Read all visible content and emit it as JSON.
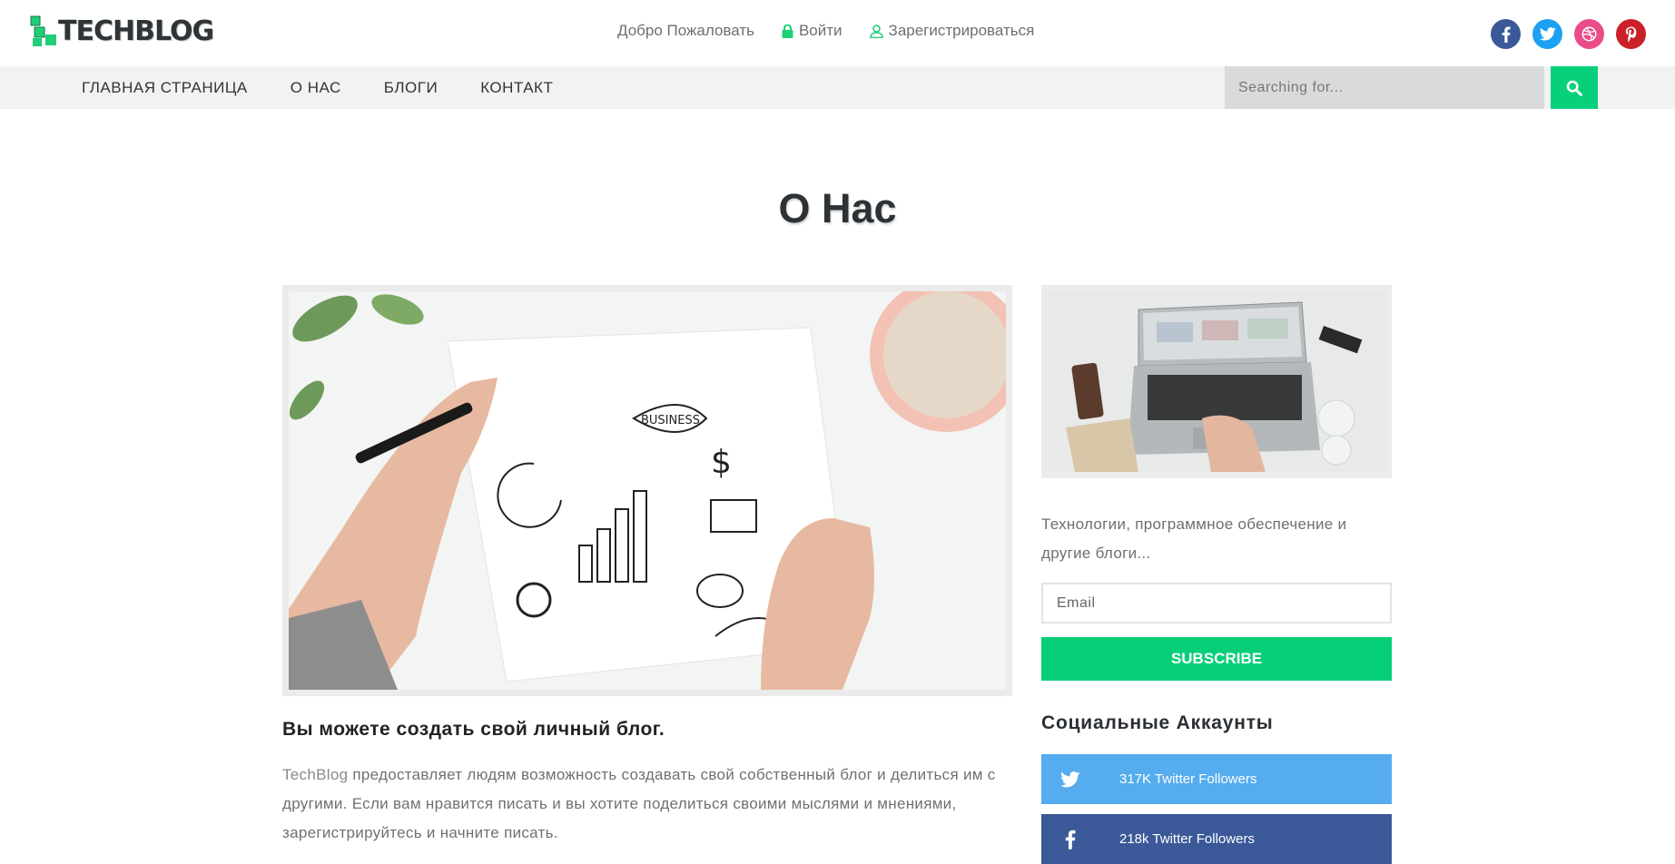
{
  "header": {
    "logo_text": "TECHBLOG",
    "nav": [
      {
        "label": "Добро Пожаловать",
        "icon": "none"
      },
      {
        "label": "Войти",
        "icon": "lock-icon"
      },
      {
        "label": "Зарегистрироваться",
        "icon": "user-icon"
      }
    ],
    "socials": [
      {
        "name": "facebook-icon",
        "glyph": "f",
        "color": "#3b5998"
      },
      {
        "name": "twitter-icon",
        "glyph": "twitter",
        "color": "#1da1f2"
      },
      {
        "name": "dribbble-icon",
        "glyph": "dribbble",
        "color": "#ea4c89"
      },
      {
        "name": "pinterest-icon",
        "glyph": "p",
        "color": "#cb2027"
      }
    ]
  },
  "navbar": {
    "items": [
      "ГЛАВНАЯ СТРАНИЦА",
      "О НАС",
      "БЛОГИ",
      "КОНТАКТ"
    ],
    "search_placeholder": "Searching for..."
  },
  "main": {
    "page_title": "О Нас",
    "post_title": "Вы можете создать свой личный блог.",
    "post_brand": "TechBlog",
    "post_text": " предоставляет людям возможность создавать свой собственный блог и делиться им с другими. Если вам нравится писать и вы хотите поделиться своими мыслями и мнениями, зарегистрируйтесь и начните писать."
  },
  "sidebar": {
    "description": "Технологии, программное обеспечение и другие блоги...",
    "email_placeholder": "Email",
    "subscribe_label": "SUBSCRIBE",
    "social_heading": "Социальные Аккаунты",
    "social_accounts": [
      {
        "label": "317K Twitter Followers",
        "icon": "twitter-icon",
        "color": "#55acee"
      },
      {
        "label": "218k Twitter Followers",
        "icon": "facebook-icon",
        "color": "#3b5998"
      }
    ]
  },
  "colors": {
    "accent": "#08d07a",
    "navbar_bg": "#f1f2f1",
    "search_bg": "#d8dadb"
  }
}
